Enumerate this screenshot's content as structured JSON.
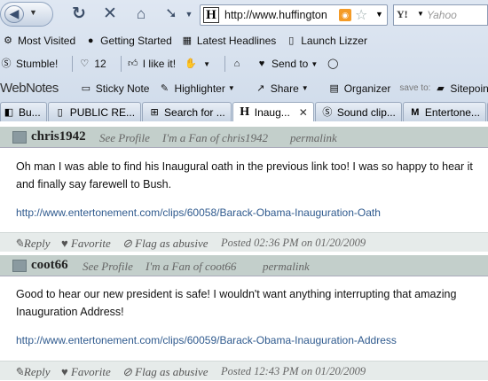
{
  "browser": {
    "url": "http://www.huffington",
    "search_placeholder": "Yahoo",
    "yahoo_logo": "Y!"
  },
  "bookmarks": [
    {
      "label": "Most Visited"
    },
    {
      "label": "Getting Started"
    },
    {
      "label": "Latest Headlines"
    },
    {
      "label": "Launch Lizzer"
    }
  ],
  "toolbar": {
    "stumble": "Stumble!",
    "like_count": "12",
    "like_label": "I like it!",
    "send_to": "Send to"
  },
  "webnotes": {
    "logo": "WebNotes",
    "sticky_note": "Sticky Note",
    "highlighter": "Highlighter",
    "share": "Share",
    "organizer": "Organizer",
    "save_to": "save to:",
    "sitepoint": "Sitepoint Tes"
  },
  "tabs": [
    {
      "label": "Bu..."
    },
    {
      "label": "PUBLIC RE..."
    },
    {
      "label": "Search for ..."
    },
    {
      "label": "Inaug...",
      "active": true
    },
    {
      "label": "Sound clip..."
    },
    {
      "label": "Entertone..."
    }
  ],
  "comments": [
    {
      "author": "chris1942",
      "see_profile": "See Profile",
      "fan": "I'm a Fan of chris1942",
      "permalink": "permalink",
      "body": "Oh man I was able to find his Inaugural oath in the previous link too! I was so happy to hear it and finally say farewell to Bush.",
      "link": "http://www.entertonement.com/clips/60058/Barack-Obama-Inauguration-Oath",
      "reply": "Reply",
      "favorite": "Favorite",
      "flag": "Flag as abusive",
      "posted": "Posted 02:36 PM on 01/20/2009"
    },
    {
      "author": "coot66",
      "see_profile": "See Profile",
      "fan": "I'm a Fan of coot66",
      "permalink": "permalink",
      "body": "Good to hear our new president is safe! I wouldn't want anything interrupting that amazing Inauguration Address!",
      "link": "http://www.entertonement.com/clips/60059/Barack-Obama-Inauguration-Address",
      "reply": "Reply",
      "favorite": "Favorite",
      "flag": "Flag as abusive",
      "posted": "Posted 12:43 PM on 01/20/2009"
    }
  ],
  "colors": {
    "comment_header": "#c3cfcb",
    "link": "#2f5a8e",
    "footer": "#e6ebea"
  }
}
